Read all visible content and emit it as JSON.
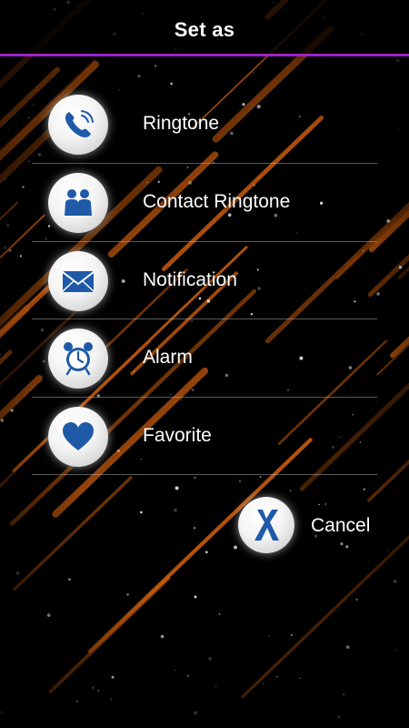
{
  "header": {
    "title": "Set as",
    "accent_color": "#a020c8"
  },
  "options": [
    {
      "label": "Ringtone",
      "icon": "phone-icon"
    },
    {
      "label": "Contact Ringtone",
      "icon": "contacts-icon"
    },
    {
      "label": "Notification",
      "icon": "envelope-icon"
    },
    {
      "label": "Alarm",
      "icon": "alarm-clock-icon"
    },
    {
      "label": "Favorite",
      "icon": "heart-icon"
    }
  ],
  "cancel": {
    "label": "Cancel",
    "icon": "close-x-icon"
  },
  "colors": {
    "icon_blue": "#1e5aa8",
    "background": "#000000"
  }
}
